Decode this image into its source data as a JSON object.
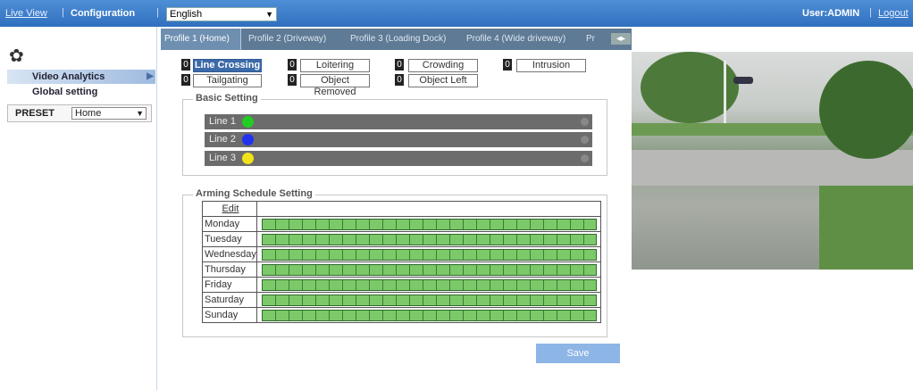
{
  "topbar": {
    "live_view": "Live View",
    "sep1": "|",
    "configuration": "Configuration",
    "sep2": "|",
    "language": "English",
    "user": "User:ADMIN",
    "sep3": "|",
    "logout": "Logout"
  },
  "sidebar": {
    "gear_icon": "gear-icon",
    "video_analytics": "Video Analytics",
    "global_setting": "Global setting",
    "preset_label": "PRESET",
    "preset_value": "Home"
  },
  "tabs": [
    {
      "label": "Profile 1  (Home)"
    },
    {
      "label": "Profile 2  (Driveway)"
    },
    {
      "label": "Profile 3  (Loading Dock)"
    },
    {
      "label": "Profile 4  (Wide driveway)"
    },
    {
      "label": "Pr"
    }
  ],
  "algorithms": [
    {
      "count": "0",
      "label": "Line Crossing"
    },
    {
      "count": "0",
      "label": "Loitering"
    },
    {
      "count": "0",
      "label": "Crowding"
    },
    {
      "count": "0",
      "label": "Intrusion"
    },
    {
      "count": "0",
      "label": "Tailgating"
    },
    {
      "count": "0",
      "label": "Object Removed"
    },
    {
      "count": "0",
      "label": "Object Left"
    }
  ],
  "basic_setting": {
    "title": "Basic Setting",
    "lines": [
      {
        "label": "Line 1",
        "color": "#22cc22"
      },
      {
        "label": "Line 2",
        "color": "#2233ee"
      },
      {
        "label": "Line 3",
        "color": "#f2e21a"
      }
    ]
  },
  "schedule": {
    "title": "Arming Schedule Setting",
    "edit": "Edit",
    "days": [
      "Monday",
      "Tuesday",
      "Wednesday",
      "Thursday",
      "Friday",
      "Saturday",
      "Sunday"
    ]
  },
  "save_label": "Save"
}
